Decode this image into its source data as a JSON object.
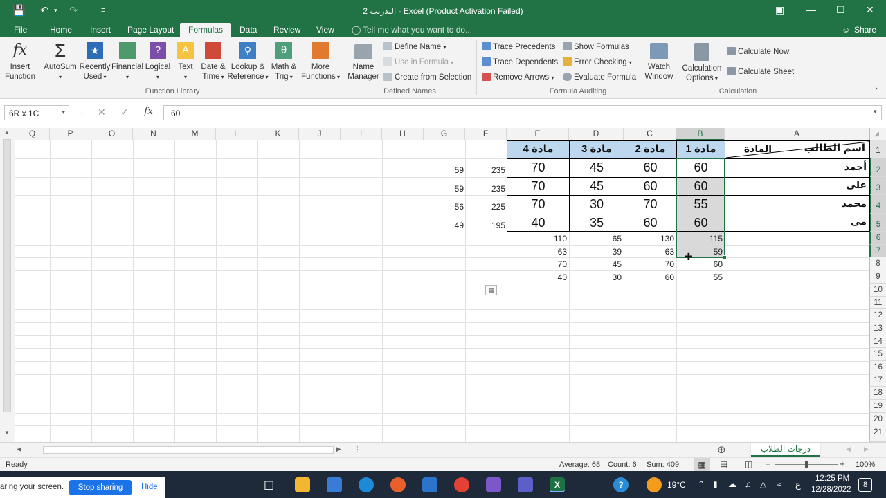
{
  "window": {
    "title": "التدريب 2 - Excel (Product Activation Failed)"
  },
  "menu": {
    "tabs": [
      "File",
      "Home",
      "Insert",
      "Page Layout",
      "Formulas",
      "Data",
      "Review",
      "View"
    ],
    "tell_me": "Tell me what you want to do...",
    "share": "Share"
  },
  "ribbon": {
    "insert_function": [
      "Insert",
      "Function"
    ],
    "autosum": "AutoSum",
    "recently_used": [
      "Recently",
      "Used"
    ],
    "financial": "Financial",
    "logical": "Logical",
    "text": "Text",
    "date_time": [
      "Date &",
      "Time"
    ],
    "lookup_reference": [
      "Lookup &",
      "Reference"
    ],
    "math_trig": [
      "Math &",
      "Trig"
    ],
    "more_functions": [
      "More",
      "Functions"
    ],
    "group_function_library": "Function Library",
    "name_manager": [
      "Name",
      "Manager"
    ],
    "define_name": "Define Name",
    "use_in_formula": "Use in Formula",
    "create_from_selection": "Create from Selection",
    "group_defined_names": "Defined Names",
    "trace_precedents": "Trace Precedents",
    "trace_dependents": "Trace Dependents",
    "remove_arrows": "Remove Arrows",
    "show_formulas": "Show Formulas",
    "error_checking": "Error Checking",
    "evaluate_formula": "Evaluate Formula",
    "watch_window": [
      "Watch",
      "Window"
    ],
    "group_formula_auditing": "Formula Auditing",
    "calculation_options": [
      "Calculation",
      "Options"
    ],
    "calculate_now": "Calculate Now",
    "calculate_sheet": "Calculate Sheet",
    "group_calculation": "Calculation"
  },
  "formula_bar": {
    "name_box": "6R x 1C",
    "fx": "fx",
    "value": "60"
  },
  "columns": [
    "Q",
    "P",
    "O",
    "N",
    "M",
    "L",
    "K",
    "J",
    "I",
    "H",
    "G",
    "F",
    "E",
    "D",
    "C",
    "B",
    "A"
  ],
  "rows": [
    "1",
    "2",
    "3",
    "4",
    "5",
    "6",
    "7",
    "8",
    "9",
    "10",
    "11",
    "12",
    "13",
    "14",
    "15",
    "16",
    "17",
    "18",
    "19",
    "20",
    "21"
  ],
  "table": {
    "header_name": "اسم الطالب",
    "header_subject": "المادة",
    "subjects": [
      "مادة 1",
      "مادة 2",
      "مادة 3",
      "مادة 4"
    ],
    "students": [
      {
        "name": "أحمد",
        "b": "60",
        "c": "60",
        "d": "45",
        "e": "70",
        "f": "235",
        "g": "59"
      },
      {
        "name": "على",
        "b": "60",
        "c": "60",
        "d": "45",
        "e": "70",
        "f": "235",
        "g": "59"
      },
      {
        "name": "محمد",
        "b": "55",
        "c": "70",
        "d": "30",
        "e": "70",
        "f": "225",
        "g": "56"
      },
      {
        "name": "مى",
        "b": "60",
        "c": "60",
        "d": "35",
        "e": "40",
        "f": "195",
        "g": "49"
      }
    ],
    "summary_rows": [
      {
        "b": "115",
        "c": "130",
        "d": "65",
        "e": "110"
      },
      {
        "b": "59",
        "c": "63",
        "d": "39",
        "e": "63"
      },
      {
        "b": "60",
        "c": "70",
        "d": "45",
        "e": "70"
      },
      {
        "b": "55",
        "c": "60",
        "d": "30",
        "e": "40"
      }
    ]
  },
  "sheet_tab": "درجات الطلاب",
  "status": {
    "ready": "Ready",
    "average": "Average: 68",
    "count": "Count: 6",
    "sum": "Sum: 409",
    "zoom": "100%"
  },
  "share_bar": {
    "text": "aring your screen.",
    "stop": "Stop sharing",
    "hide": "Hide"
  },
  "taskbar": {
    "weather": "19°C",
    "time": "12:25 PM",
    "date": "12/28/2022",
    "lang": "ع",
    "notif": "8"
  },
  "colors": {
    "excel_green": "#217346",
    "header_fill": "#bdd7ee",
    "selection_fill": "#d9d9d9"
  }
}
